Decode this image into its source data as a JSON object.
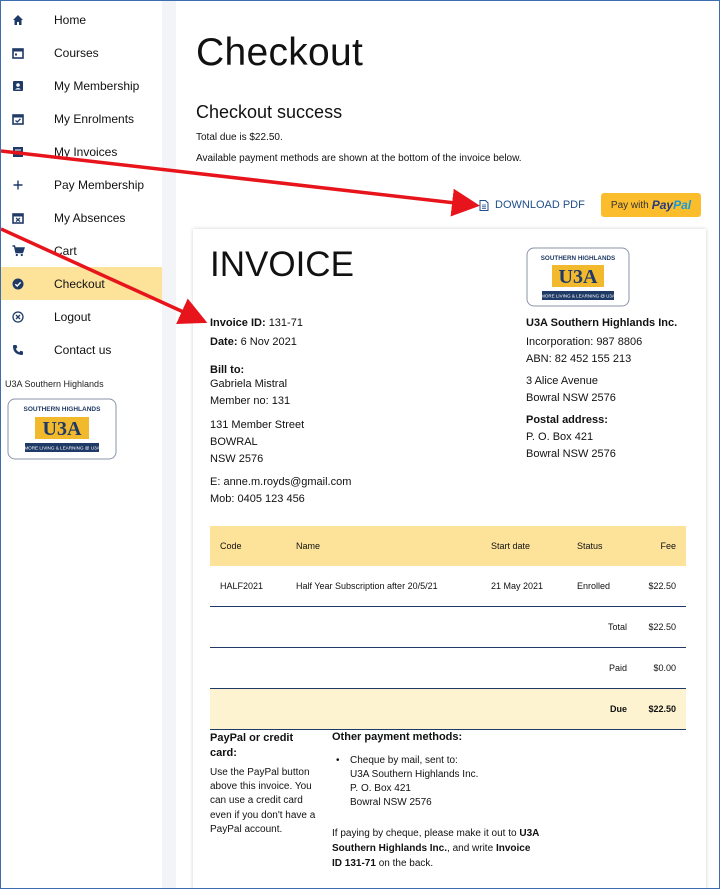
{
  "sidebar": {
    "items": [
      {
        "label": "Home",
        "icon": "home-icon"
      },
      {
        "label": "Courses",
        "icon": "calendar-icon"
      },
      {
        "label": "My Membership",
        "icon": "id-card-icon"
      },
      {
        "label": "My Enrolments",
        "icon": "calendar-check-icon"
      },
      {
        "label": "My Invoices",
        "icon": "list-icon"
      },
      {
        "label": "Pay Membership",
        "icon": "plus-icon"
      },
      {
        "label": "My Absences",
        "icon": "calendar-x-icon"
      },
      {
        "label": "Cart",
        "icon": "cart-icon"
      },
      {
        "label": "Checkout",
        "icon": "check-circle-icon"
      },
      {
        "label": "Logout",
        "icon": "x-circle-icon"
      },
      {
        "label": "Contact us",
        "icon": "phone-icon"
      }
    ],
    "active": "Checkout",
    "org_name": "U3A Southern Highlands",
    "logo": {
      "top": "SOUTHERN HIGHLANDS",
      "mark": "U3A",
      "bottom": "MORE LIVING & LEARNING @ U3A"
    }
  },
  "page": {
    "title": "Checkout",
    "subtitle": "Checkout success",
    "total_due_line": "Total due is $22.50.",
    "methods_line": "Available payment methods are shown at the bottom of the invoice below."
  },
  "actions": {
    "download_label": "DOWNLOAD PDF",
    "paypal_prefix": "Pay with",
    "paypal_pay": "Pay",
    "paypal_pal": "Pal"
  },
  "invoice": {
    "title": "INVOICE",
    "invoice_id_label": "Invoice ID:",
    "invoice_id": "131-71",
    "date_label": "Date:",
    "date": "6 Nov 2021",
    "bill_to_label": "Bill to:",
    "member_name": "Gabriela Mistral",
    "member_no": "Member no: 131",
    "address1": "131 Member Street",
    "address2": "BOWRAL",
    "address3": "NSW 2576",
    "email": "E: anne.m.royds@gmail.com",
    "mobile": "Mob: 0405 123 456",
    "org_name": "U3A Southern Highlands Inc.",
    "incorporation": "Incorporation: 987 8806",
    "abn": "ABN: 82 452 155 213",
    "org_addr1": "3 Alice Avenue",
    "org_addr2": "Bowral NSW 2576",
    "postal_label": "Postal address:",
    "postal1": "P. O. Box 421",
    "postal2": "Bowral NSW 2576",
    "table": {
      "headers": [
        "Code",
        "Name",
        "Start date",
        "Status",
        "Fee"
      ],
      "rows": [
        [
          "HALF2021",
          "Half Year Subscription after 20/5/21",
          "21 May 2021",
          "Enrolled",
          "$22.50"
        ]
      ],
      "total_label": "Total",
      "total": "$22.50",
      "paid_label": "Paid",
      "paid": "$0.00",
      "due_label": "Due",
      "due": "$22.50"
    },
    "paypal_heading": "PayPal or credit card:",
    "paypal_text": "Use the PayPal button above this invoice. You can use a credit card even if you don't have a PayPal account.",
    "other_heading": "Other payment methods:",
    "cheque_line1": "Cheque by mail, sent to:",
    "cheque_line2": "U3A Southern Highlands Inc.",
    "cheque_line3": "P. O. Box 421",
    "cheque_line4": "Bowral NSW 2576",
    "note_pre": "If paying by cheque, please make it out to ",
    "note_org": "U3A Southern Highlands Inc.",
    "note_mid": ", and write ",
    "note_id": "Invoice ID 131-71",
    "note_post": " on the back."
  },
  "colors": {
    "accent_yellow": "#fde39a",
    "paypal_yellow": "#fcbd2c",
    "nav_blue": "#1f3a66",
    "annotation_red": "#e8141b"
  }
}
